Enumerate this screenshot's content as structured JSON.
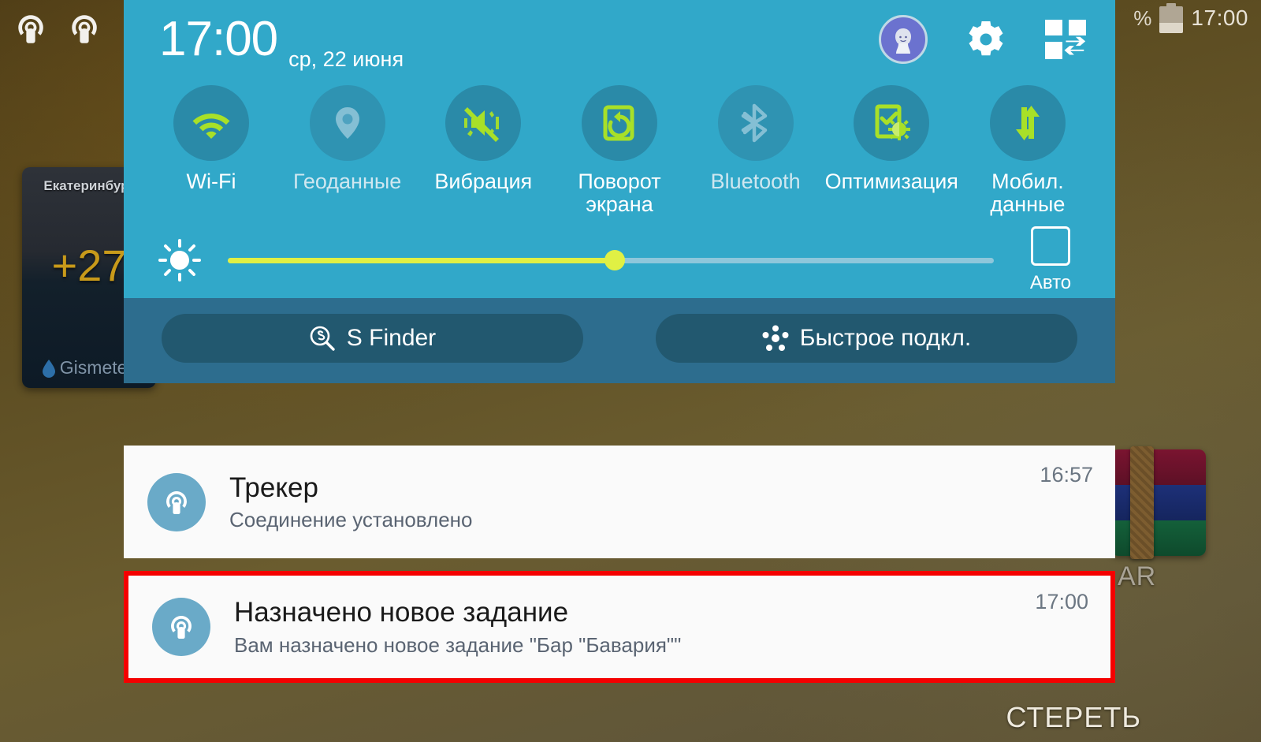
{
  "status_bar": {
    "battery_percent_fragment": "%",
    "time": "17:00",
    "battery_icon": "battery-icon"
  },
  "home_screen": {
    "tracker_icons": [
      "tracker-broadcast-icon",
      "tracker-broadcast-icon"
    ],
    "weather_widget": {
      "city": "Екатеринбург",
      "temperature": "+27",
      "brand": "Gismeteo",
      "drop_icon": "water-drop-icon"
    },
    "band_widget": {
      "label": "AR",
      "icon": "fitness-band-icon"
    }
  },
  "quick_settings": {
    "clock": "17:00",
    "date": "ср, 22 июня",
    "header_icons": [
      {
        "name": "user-avatar",
        "icon": "user-avatar-icon"
      },
      {
        "name": "settings",
        "icon": "gear-icon"
      },
      {
        "name": "edit-quick-settings",
        "icon": "grid-swap-icon"
      }
    ],
    "toggles": [
      {
        "label": "Wi-Fi",
        "icon": "wifi-icon",
        "active": true
      },
      {
        "label": "Геоданные",
        "icon": "location-pin-icon",
        "active": false
      },
      {
        "label": "Вибрация",
        "icon": "vibrate-icon",
        "active": true
      },
      {
        "label": "Поворот экрана",
        "icon": "rotate-icon",
        "active": true
      },
      {
        "label": "Bluetooth",
        "icon": "bluetooth-icon",
        "active": false
      },
      {
        "label": "Оптимизация",
        "icon": "optimize-icon",
        "active": true
      },
      {
        "label": "Мобил. данные",
        "icon": "data-arrows-icon",
        "active": true
      }
    ],
    "brightness": {
      "icon": "brightness-icon",
      "value_percent": 50,
      "auto_label": "Авто",
      "auto_checked": false
    },
    "buttons": [
      {
        "label": "S Finder",
        "icon": "s-finder-icon"
      },
      {
        "label": "Быстрое подкл.",
        "icon": "quick-connect-icon"
      }
    ]
  },
  "notifications": [
    {
      "icon": "tracker-broadcast-icon",
      "title": "Трекер",
      "subtitle": "Соединение установлено",
      "time": "16:57"
    },
    {
      "icon": "tracker-broadcast-icon",
      "title": "Назначено новое задание",
      "subtitle": "Вам назначено новое задание \"Бар \"Бавария\"\"",
      "time": "17:00"
    }
  ],
  "clear_button": {
    "label": "СТЕРЕТЬ"
  },
  "colors": {
    "panel_top": "#31a8c9",
    "panel_bottom": "#2d6d8e",
    "button_fill": "#22586f",
    "accent_green": "#a8e028",
    "slider_fill": "#e0f044",
    "highlight_border": "#f40000",
    "notification_bg": "#fafafa"
  }
}
